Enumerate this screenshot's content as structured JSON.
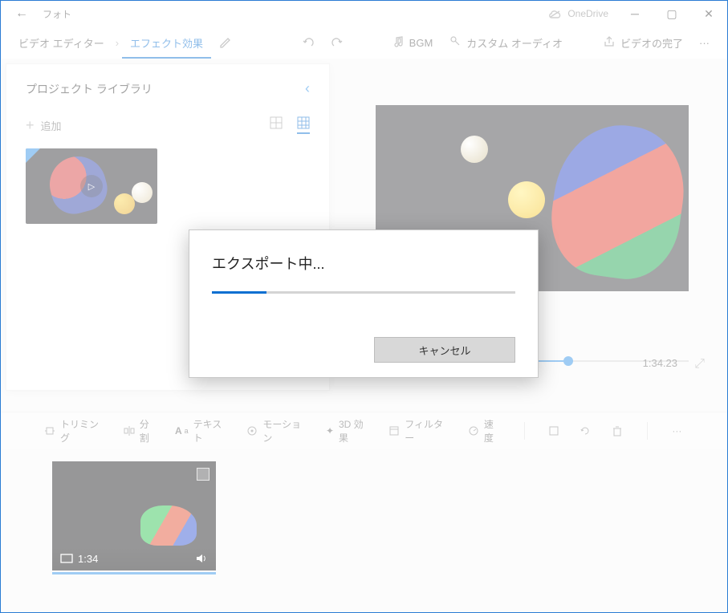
{
  "titlebar": {
    "app_title": "フォト",
    "onedrive_label": "OneDrive"
  },
  "toolbar": {
    "video_editor": "ビデオ エディター",
    "effects": "エフェクト効果",
    "bgm": "BGM",
    "custom_audio": "カスタム オーディオ",
    "finish_video": "ビデオの完了"
  },
  "left_panel": {
    "title": "プロジェクト ライブラリ",
    "add_label": "追加"
  },
  "preview": {
    "timecode": "1:34.23"
  },
  "dialog": {
    "title": "エクスポート中...",
    "cancel_label": "キャンセル",
    "progress_percent": 18
  },
  "bottom_toolbar": {
    "trimming": "トリミング",
    "split": "分割",
    "text": "テキスト",
    "motion": "モーション",
    "threeD": "3D 効果",
    "filter": "フィルター",
    "speed": "速度"
  },
  "storyboard": {
    "clip_duration": "1:34"
  }
}
